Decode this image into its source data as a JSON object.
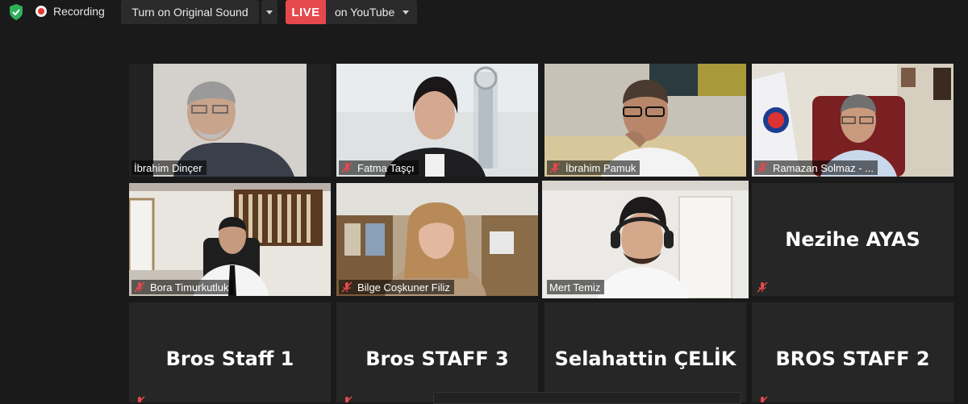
{
  "toolbar": {
    "shield_icon": "shield-check-icon",
    "recording_label": "Recording",
    "sound_button_label": "Turn on Original Sound",
    "live_badge": "LIVE",
    "live_destination": "on YouTube"
  },
  "colors": {
    "background": "#1a1a1a",
    "live_badge": "#e5484d",
    "active_speaker_border": "#b9d25b",
    "mic_muted": "#e5484d"
  },
  "participants": [
    {
      "name": "İbrahim Dinçer",
      "video": true,
      "muted": false
    },
    {
      "name": "Fatma Taşçı",
      "video": true,
      "muted": true
    },
    {
      "name": "İbrahim Pamuk",
      "video": true,
      "muted": true
    },
    {
      "name": "Ramazan Solmaz - ...",
      "video": true,
      "muted": true
    },
    {
      "name": "Bora Timurkutluk",
      "video": true,
      "muted": true
    },
    {
      "name": "Bilge Coşkuner Filiz",
      "video": true,
      "muted": true
    },
    {
      "name": "Mert Temiz",
      "video": true,
      "muted": false,
      "active_speaker": true
    },
    {
      "name": "Nezihe AYAS",
      "video": false,
      "muted": true
    },
    {
      "name": "Bros Staff 1",
      "video": false,
      "muted": true
    },
    {
      "name": "Bros STAFF 3",
      "video": false,
      "muted": true
    },
    {
      "name": "Selahattin ÇELİK",
      "video": false,
      "muted": false
    },
    {
      "name": "BROS STAFF 2",
      "video": false,
      "muted": true
    }
  ]
}
